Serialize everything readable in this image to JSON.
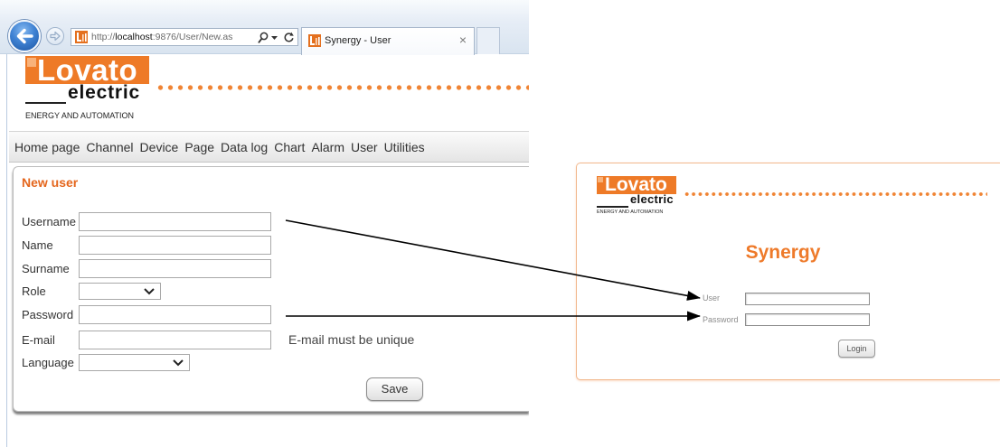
{
  "browser": {
    "url": {
      "scheme": "http://",
      "host": "localhost",
      "rest": ":9876/User/New.as"
    },
    "tab_title": "Synergy - User",
    "tab_close": "×"
  },
  "icons": {
    "back": "back-arrow-icon",
    "forward": "forward-arrow-icon",
    "favicon": "lovato-favicon-icon",
    "search": "search-icon",
    "address_dropdown": "chevron-down-icon",
    "refresh": "refresh-icon",
    "select_arrow": "chevron-down-icon"
  },
  "header": {
    "logo": {
      "brand": "Lovato",
      "sub": "electric",
      "tagline": "ENERGY AND AUTOMATION"
    }
  },
  "nav": {
    "items": [
      "Home page",
      "Channel",
      "Device",
      "Page",
      "Data log",
      "Chart",
      "Alarm",
      "User",
      "Utilities"
    ]
  },
  "new_user_form": {
    "title": "New user",
    "fields": [
      {
        "label": "Username",
        "value": ""
      },
      {
        "label": "Name",
        "value": ""
      },
      {
        "label": "Surname",
        "value": ""
      },
      {
        "label": "Role",
        "selected": ""
      },
      {
        "label": "Password",
        "value": ""
      },
      {
        "label": "E-mail",
        "value": ""
      },
      {
        "label": "Language",
        "selected": ""
      }
    ],
    "email_hint": "E-mail must be unique",
    "save_label": "Save"
  },
  "login_panel": {
    "logo": {
      "brand": "Lovato",
      "sub": "electric",
      "tagline": "ENERGY AND AUTOMATION"
    },
    "title": "Synergy",
    "user_label": "User",
    "user_value": "",
    "password_label": "Password",
    "password_value": "",
    "login_label": "Login"
  },
  "colors": {
    "accent_orange": "#ee7a27",
    "title_orange": "#e4661d",
    "login_border": "#f2b88e",
    "back_button_blue": "#3f82d3"
  }
}
